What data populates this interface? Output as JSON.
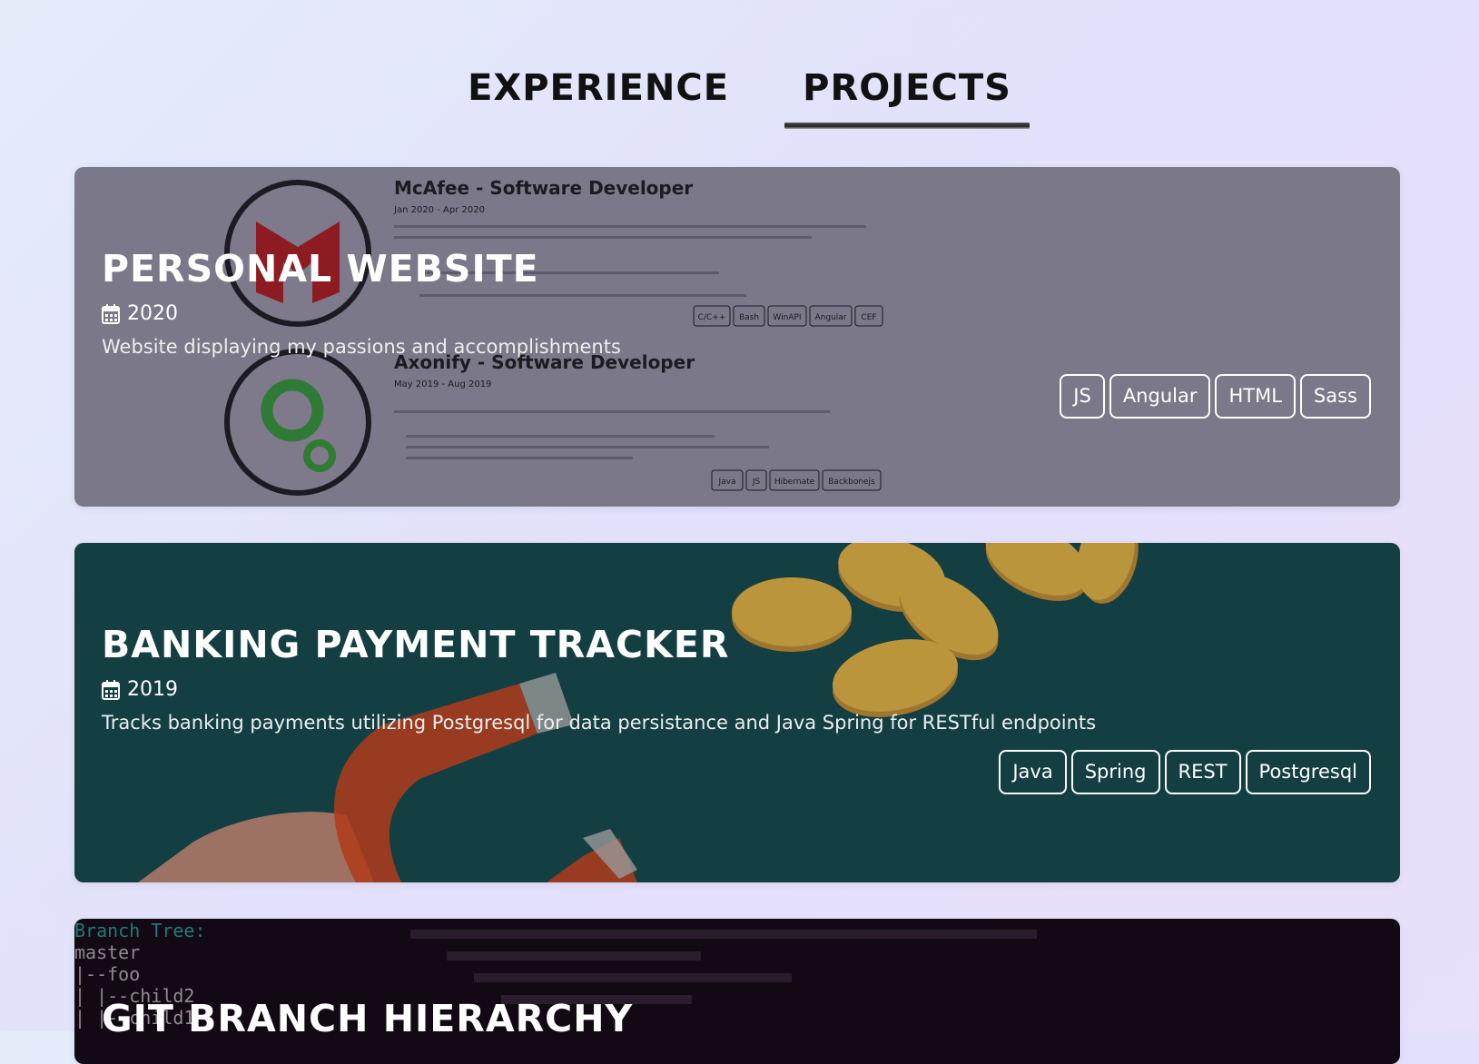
{
  "tabs": [
    {
      "label": "EXPERIENCE",
      "active": false
    },
    {
      "label": "PROJECTS",
      "active": true
    }
  ],
  "projects": [
    {
      "title": "PERSONAL WEBSITE",
      "year": "2020",
      "description": "Website displaying my passions and accomplishments",
      "tags": [
        "JS",
        "Angular",
        "HTML",
        "Sass"
      ],
      "background": {
        "entries": [
          {
            "heading": "McAfee - Software Developer",
            "dates": "Jan 2020 - Apr 2020",
            "tags": [
              "C/C++",
              "Bash",
              "WinAPI",
              "Angular",
              "CEF"
            ]
          },
          {
            "heading": "Axonify - Software Developer",
            "dates": "May 2019 - Aug 2019",
            "tags": [
              "Java",
              "JS",
              "Hibernate",
              "Backbonejs"
            ]
          }
        ]
      }
    },
    {
      "title": "BANKING PAYMENT TRACKER",
      "year": "2019",
      "description": "Tracks banking payments utilizing Postgresql for data persistance and Java Spring for RESTful endpoints",
      "tags": [
        "Java",
        "Spring",
        "REST",
        "Postgresql"
      ]
    },
    {
      "title": "GIT BRANCH HIERARCHY",
      "background": {
        "tree_lines": [
          "Branch Tree:",
          "master",
          "|--foo",
          "|  |--child2",
          "|  |--child1"
        ]
      }
    }
  ],
  "colors": {
    "card1": "#7b7889",
    "card2": "#133f43",
    "card3": "#130914"
  }
}
